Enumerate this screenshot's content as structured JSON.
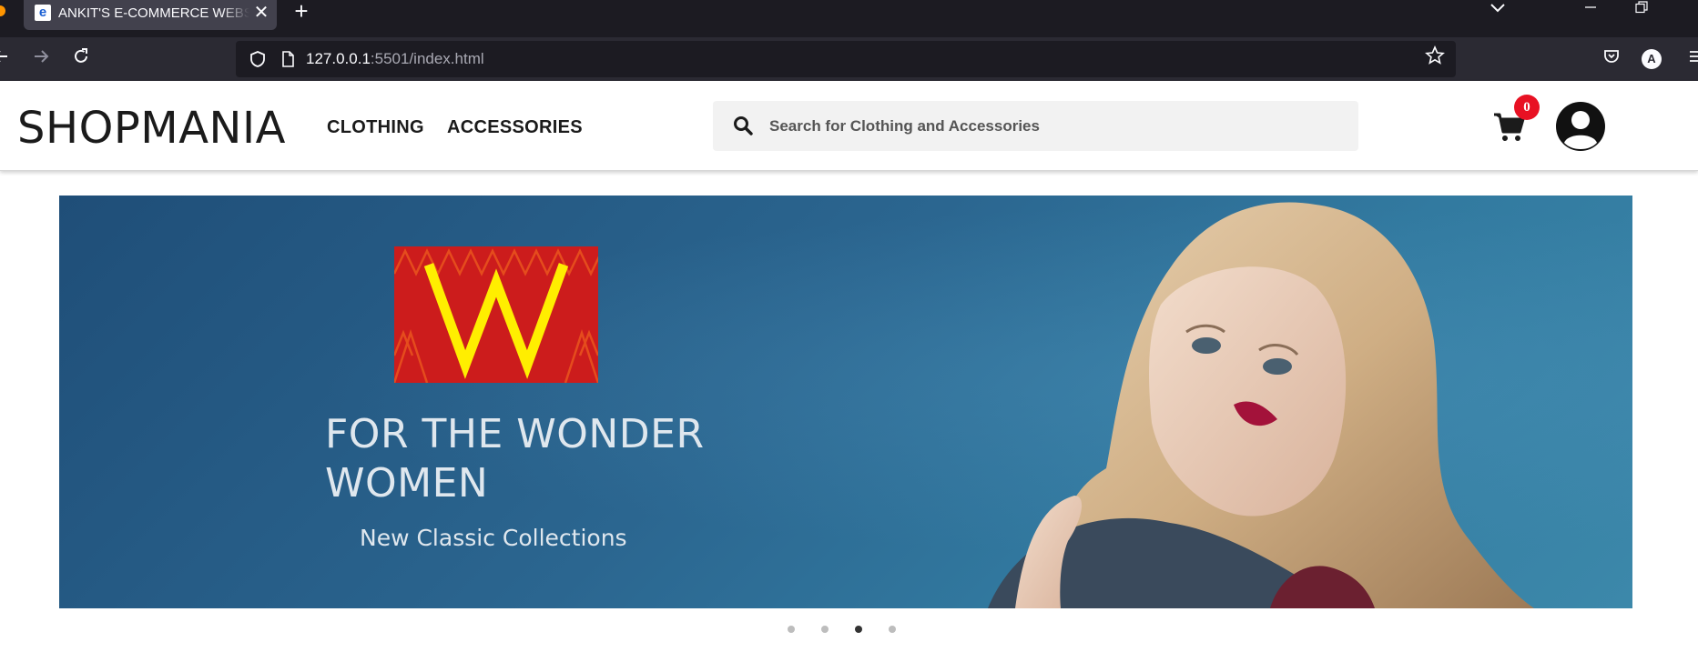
{
  "browser": {
    "tab_title": "ANKIT'S E-COMMERCE WEBSITE",
    "url_host": "127.0.0.1",
    "url_rest": ":5501/index.html",
    "close_glyph": "✕",
    "new_tab_glyph": "+",
    "tab_list_glyph": "⌵",
    "account_letter": "A",
    "icons": [
      "back-icon",
      "forward-icon",
      "reload-icon",
      "shield-icon",
      "page-icon",
      "star-icon",
      "pocket-icon",
      "account-icon",
      "menu-icon",
      "minimize-icon",
      "restore-icon"
    ]
  },
  "site": {
    "logo": "SHOPMANIA",
    "nav": [
      "CLOTHING",
      "ACCESSORIES"
    ],
    "search_placeholder": "Search for Clothing and Accessories",
    "cart_count": "0"
  },
  "banner": {
    "brand_letter": "W",
    "heading": "FOR THE WONDER WOMEN",
    "subheading": "New Classic Collections",
    "colors": {
      "background": "#2b6690",
      "brand_red": "#cc1c1c",
      "brand_yellow": "#ffee00"
    }
  },
  "carousel": {
    "slide_count": 4,
    "active_index": 2
  }
}
